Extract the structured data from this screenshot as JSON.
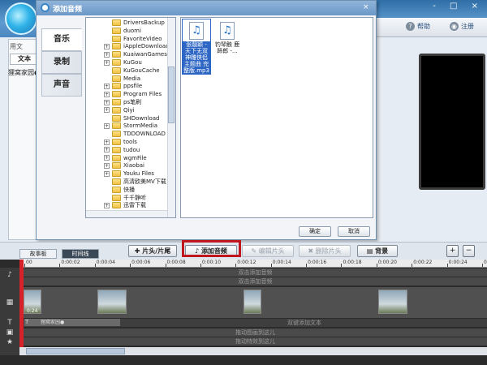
{
  "app": {
    "help_label": "帮助",
    "logout_label": "注册",
    "used_text_label": "用文",
    "text_tab": "文本",
    "left_item": "狸窝家园●",
    "window_controls": "- □ ×"
  },
  "dialog": {
    "title": "添加音频",
    "close": "×",
    "tabs": [
      "音乐",
      "录制",
      "声音"
    ],
    "tree": [
      {
        "label": "DriversBackup",
        "pm": ""
      },
      {
        "label": "duomi",
        "pm": ""
      },
      {
        "label": "FavoriteVideo",
        "pm": ""
      },
      {
        "label": "iAppleDownloads",
        "pm": "+"
      },
      {
        "label": "KuaiwanGames",
        "pm": "+"
      },
      {
        "label": "KuGou",
        "pm": "+"
      },
      {
        "label": "KuGouCache",
        "pm": ""
      },
      {
        "label": "Media",
        "pm": ""
      },
      {
        "label": "ppsfile",
        "pm": "+"
      },
      {
        "label": "Program Files",
        "pm": "+"
      },
      {
        "label": "ps笔刷",
        "pm": "+"
      },
      {
        "label": "Qiyi",
        "pm": "+"
      },
      {
        "label": "SHDownload",
        "pm": ""
      },
      {
        "label": "StormMedia",
        "pm": "+"
      },
      {
        "label": "TDDOWNLOAD",
        "pm": ""
      },
      {
        "label": "tools",
        "pm": "+"
      },
      {
        "label": "tudou",
        "pm": "+"
      },
      {
        "label": "wgmFile",
        "pm": "+"
      },
      {
        "label": "Xiaobai",
        "pm": "+"
      },
      {
        "label": "Youku Files",
        "pm": "+"
      },
      {
        "label": "高清欧美MV下载",
        "pm": ""
      },
      {
        "label": "快播",
        "pm": ""
      },
      {
        "label": "千千静听",
        "pm": ""
      },
      {
        "label": "迅雷下载",
        "pm": "+"
      }
    ],
    "files": [
      {
        "name": "张靓颖 - 天下无双 神雕侠侣主题曲 完整版.mp3",
        "selected": true,
        "icon": "music-note-icon"
      },
      {
        "name": "钓琴触 鹿蹄郎 -...",
        "selected": false,
        "icon": "music-note-icon"
      }
    ],
    "ok_label": "确定",
    "cancel_label": "取消"
  },
  "toolbar": {
    "storyboard_tab": "故事板",
    "timeline_tab": "时间线",
    "add_clip": "片头/片尾",
    "add_audio": "添加音频",
    "edit_clip": "编辑片头",
    "delete_clip": "删除片头",
    "background": "背景",
    "zoom_in": "+",
    "zoom_out": "−"
  },
  "timeline": {
    "ruler_marks": [
      "00",
      "0:00:02",
      "0:00:04",
      "0:00:06",
      "0:00:08",
      "0:00:10",
      "0:00:12",
      "0:00:14",
      "0:00:16",
      "0:00:18",
      "0:00:20",
      "0:00:22",
      "0:00:24",
      "0:00:26"
    ],
    "lane_audio1": "双击添加音频",
    "lane_audio2": "双击添加音频",
    "clip_time": "0:24",
    "text_clip": "狸窝家园●",
    "lane_text": "双键添加文本",
    "lane_anim1": "拖动图画到这儿",
    "lane_anim2": "拖动特效到这儿",
    "icon_music": "♪",
    "icon_video": "▦",
    "icon_text": "T",
    "icon_photo": "▣",
    "icon_star": "★",
    "text_icon_label": "T",
    "accent_red": "#c0171e"
  }
}
